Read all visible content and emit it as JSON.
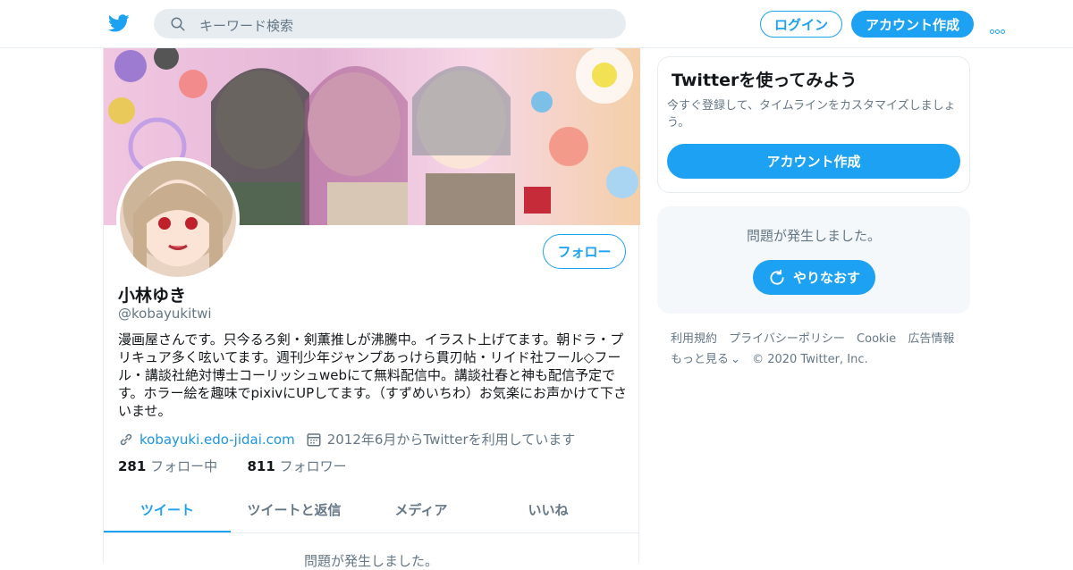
{
  "header": {
    "search_placeholder": "キーワード検索",
    "login_label": "ログイン",
    "signup_label": "アカウント作成"
  },
  "profile": {
    "name": "小林ゆき",
    "handle": "@kobayukitwi",
    "bio": "漫画屋さんです。只今るろ剣・剣薫推しが沸騰中。イラスト上げてます。朝ドラ・プリキュア多く呟いてます。週刊少年ジャンプあっけら貫刃帖・リイド社フール◇フール・講談社絶対博士コーリッシュwebにて無料配信中。講談社春と神も配信予定です。ホラー絵を趣味でpixivにUPしてます。（すずめいちわ）お気楽にお声かけて下さいませ。",
    "website": "kobayuki.edo-jidai.com",
    "joined": "2012年6月からTwitterを利用しています",
    "following_count": "281",
    "following_label": "フォロー中",
    "followers_count": "811",
    "followers_label": "フォロワー",
    "follow_label": "フォロー"
  },
  "tabs": [
    {
      "label": "ツイート",
      "active": true
    },
    {
      "label": "ツイートと返信",
      "active": false
    },
    {
      "label": "メディア",
      "active": false
    },
    {
      "label": "いいね",
      "active": false
    }
  ],
  "timeline": {
    "error_text": "問題が発生しました。"
  },
  "sidebar": {
    "card_title": "Twitterを使ってみよう",
    "card_text": "今すぐ登録して、タイムラインをカスタマイズしましょう。",
    "card_button": "アカウント作成",
    "error_text": "問題が発生しました。",
    "retry_label": "やりなおす"
  },
  "footer": {
    "terms": "利用規約",
    "privacy": "プライバシーポリシー",
    "cookie": "Cookie",
    "ads": "広告情報",
    "more": "もっと見る",
    "copyright": "© 2020 Twitter, Inc."
  },
  "colors": {
    "accent": "#1da1f2",
    "muted": "#657786",
    "text": "#14171a",
    "border": "#e6ecf0"
  }
}
